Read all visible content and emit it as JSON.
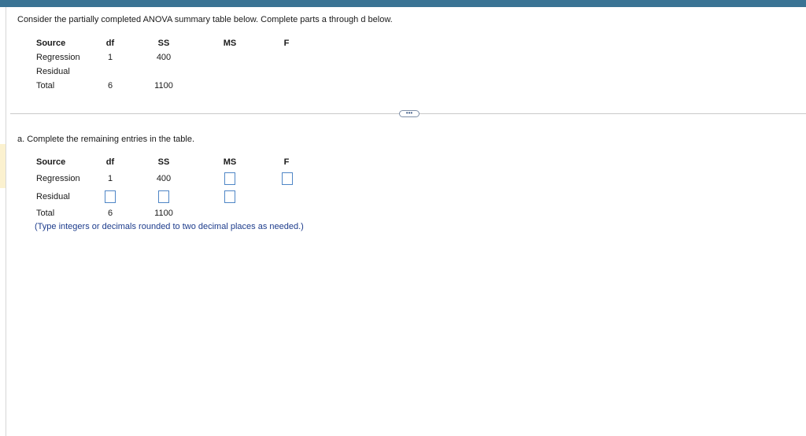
{
  "question": {
    "intro": "Consider the partially completed ANOVA summary table below. Complete parts a through d below."
  },
  "summary_table": {
    "headers": [
      "Source",
      "df",
      "SS",
      "MS",
      "F"
    ],
    "rows": [
      {
        "source": "Regression",
        "df": "1",
        "ss": "400"
      },
      {
        "source": "Residual",
        "df": "",
        "ss": ""
      },
      {
        "source": "Total",
        "df": "6",
        "ss": "1100"
      }
    ]
  },
  "more_button": {
    "label": "•••"
  },
  "part_a": {
    "prompt": "a. Complete the remaining entries in the table.",
    "headers": [
      "Source",
      "df",
      "SS",
      "MS",
      "F"
    ],
    "rows": [
      {
        "source": "Regression",
        "df": "1",
        "ss": "400",
        "ms": "",
        "f": ""
      },
      {
        "source": "Residual",
        "df": "",
        "ss": "",
        "ms": ""
      },
      {
        "source": "Total",
        "df": "6",
        "ss": "1100"
      }
    ],
    "hint": "(Type integers or decimals rounded to two decimal places as needed.)"
  },
  "colors": {
    "topbar": "#3a7394",
    "input_border": "#4f86c6",
    "hint_text": "#1d3c8c"
  }
}
